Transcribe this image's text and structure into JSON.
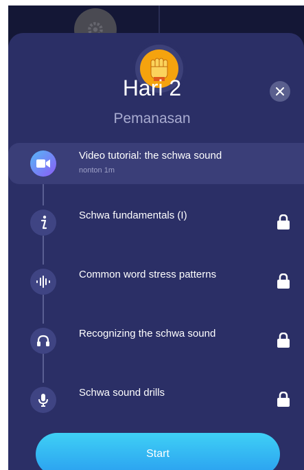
{
  "header": {
    "title": "Hari 2",
    "subtitle": "Pemanasan"
  },
  "steps": [
    {
      "title": "Video tutorial: the schwa sound",
      "subtitle": "nonton 1m",
      "icon": "video-camera-icon",
      "locked": false
    },
    {
      "title": "Schwa fundamentals (I)",
      "icon": "info-icon",
      "locked": true
    },
    {
      "title": "Common word stress patterns",
      "icon": "audio-wave-icon",
      "locked": true
    },
    {
      "title": "Recognizing the schwa sound",
      "icon": "headphones-icon",
      "locked": true
    },
    {
      "title": "Schwa sound drills",
      "icon": "microphone-icon",
      "locked": true
    }
  ],
  "actions": {
    "start_label": "Start"
  },
  "colors": {
    "background": "#141736",
    "sheet": "#2b2f66",
    "accent": "#35b8f3",
    "badge": "#f5a30e"
  }
}
